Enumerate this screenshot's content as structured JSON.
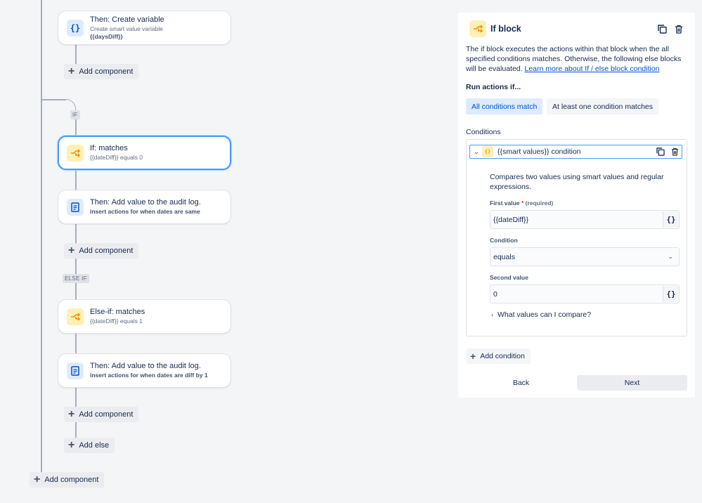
{
  "flow": {
    "cards": [
      {
        "title": "Then: Create variable",
        "sub": "Create smart value variable",
        "sub_bold": "{{daysDiff}}",
        "icon": "braces-icon"
      },
      {
        "title": "If: matches",
        "sub": "{{dateDiff}} equals 0",
        "icon": "branch-icon"
      },
      {
        "title": "Then: Add value to the audit log.",
        "sub_bold": "insert actions for when dates are same",
        "icon": "document-icon"
      },
      {
        "title": "Else-if: matches",
        "sub": "{{dateDiff}} equals 1",
        "icon": "branch-icon"
      },
      {
        "title": "Then: Add value to the audit log.",
        "sub_bold": "insert actions for when dates are diff by 1",
        "icon": "document-icon"
      }
    ],
    "add_component_label": "Add component",
    "add_else_label": "Add else",
    "if_tag": "IF",
    "else_if_tag": "ELSE IF"
  },
  "panel": {
    "title": "If block",
    "description": "The if block executes the actions within that block when the all specified conditions matches. Otherwise, the following else blocks will be evaluated.",
    "learn_more": "Learn more about If / else block condition",
    "run_actions_label": "Run actions if...",
    "options": {
      "all": "All conditions match",
      "any": "At least one condition matches"
    },
    "conditions_label": "Conditions",
    "condition": {
      "title": "{{smart values}} condition",
      "description": "Compares two values using smart values and regular expressions.",
      "first_value_label": "First value",
      "required_mark": "*",
      "required_note": "(required)",
      "first_value": "{{dateDiff}}",
      "condition_label": "Condition",
      "condition_value": "equals",
      "second_value_label": "Second value",
      "second_value": "0",
      "smart_value_btn": "{}",
      "expander": "What values can I compare?"
    },
    "add_condition": "Add condition",
    "back": "Back",
    "next": "Next"
  },
  "colors": {
    "accent": "#0052cc",
    "selected_border": "#4c9aff",
    "icon_yellow": "#fff0b3",
    "icon_blue": "#deebff"
  }
}
